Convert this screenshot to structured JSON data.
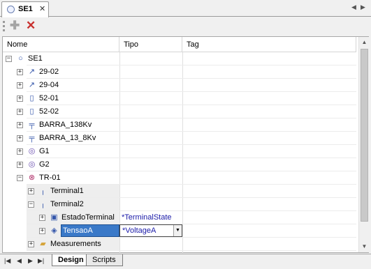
{
  "document_tab": {
    "label": "SE1",
    "close": "✕"
  },
  "columns": {
    "nome": "Nome",
    "tipo": "Tipo",
    "tag": "Tag"
  },
  "tree": [
    {
      "label": "SE1",
      "level": 0,
      "expander": "−",
      "icon": "circle-station-icon",
      "glyph": "○"
    },
    {
      "label": "29-02",
      "level": 1,
      "expander": "+",
      "icon": "switch-icon",
      "glyph": "↗"
    },
    {
      "label": "29-04",
      "level": 1,
      "expander": "+",
      "icon": "switch-icon",
      "glyph": "↗"
    },
    {
      "label": "52-01",
      "level": 1,
      "expander": "+",
      "icon": "breaker-icon",
      "glyph": "▯"
    },
    {
      "label": "52-02",
      "level": 1,
      "expander": "+",
      "icon": "breaker-icon",
      "glyph": "▯"
    },
    {
      "label": "BARRA_138Kv",
      "level": 1,
      "expander": "+",
      "icon": "busbar-icon",
      "glyph": "╤"
    },
    {
      "label": "BARRA_13_8Kv",
      "level": 1,
      "expander": "+",
      "icon": "busbar-icon",
      "glyph": "╤"
    },
    {
      "label": "G1",
      "level": 1,
      "expander": "+",
      "icon": "generator-icon",
      "glyph": "◎"
    },
    {
      "label": "G2",
      "level": 1,
      "expander": "+",
      "icon": "generator-icon",
      "glyph": "◎"
    },
    {
      "label": "TR-01",
      "level": 1,
      "expander": "−",
      "icon": "transformer-icon",
      "glyph": "⊗"
    },
    {
      "label": "Terminal1",
      "level": 2,
      "expander": "+",
      "icon": "terminal-icon",
      "glyph": "╷"
    },
    {
      "label": "Terminal2",
      "level": 2,
      "expander": "−",
      "icon": "terminal-icon",
      "glyph": "╷"
    },
    {
      "label": "EstadoTerminal",
      "level": 3,
      "expander": "+",
      "icon": "digital-point-icon",
      "glyph": "▣",
      "tipo": "*TerminalState"
    },
    {
      "label": "TensaoA",
      "level": 3,
      "expander": "+",
      "icon": "analog-point-icon",
      "glyph": "◈",
      "tipo": "*VoltageA",
      "editing": true
    },
    {
      "label": "Measurements",
      "level": 2,
      "expander": "+",
      "icon": "folder-icon",
      "glyph": "▰"
    }
  ],
  "sheets": {
    "design": "Design",
    "scripts": "Scripts"
  },
  "colors": {
    "selection": "#3a79c8",
    "tipo_text": "#1a1aa8",
    "delete_icon": "#c8302e"
  }
}
